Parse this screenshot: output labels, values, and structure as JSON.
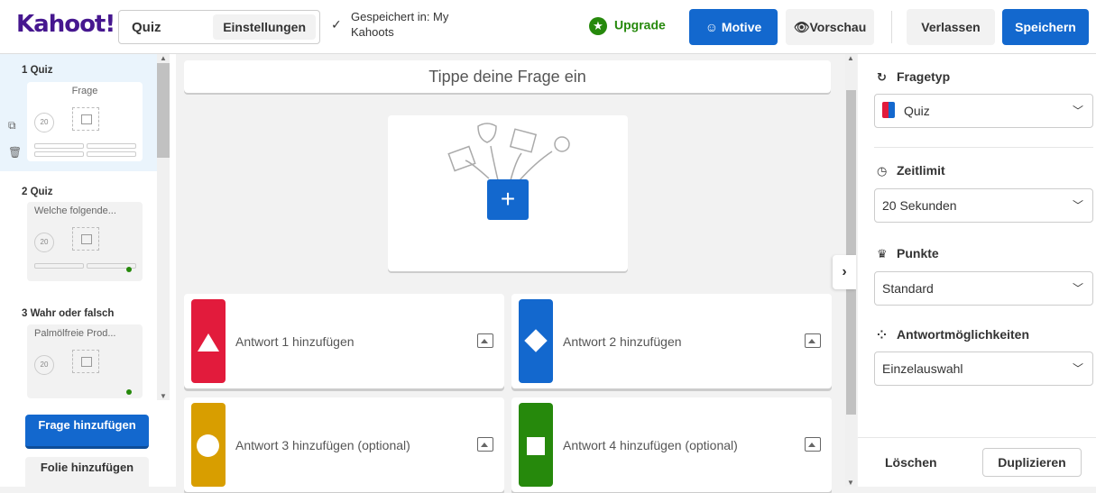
{
  "app": {
    "logo": "Kahoot!"
  },
  "header": {
    "title": "Quiz",
    "settings_label": "Einstellungen",
    "saved_text": "Gespeichert in: My Kahoots",
    "upgrade_label": "Upgrade",
    "themes_label": "Motive",
    "preview_label": "Vorschau",
    "leave_label": "Verlassen",
    "save_label": "Speichern"
  },
  "slides": [
    {
      "label": "1  Quiz",
      "question": "Frage",
      "timer": "20"
    },
    {
      "label": "2  Quiz",
      "question": "Welche folgende...",
      "timer": "20"
    },
    {
      "label": "3  Wahr oder falsch",
      "question": "Palmölfreie Prod...",
      "timer": "20"
    }
  ],
  "sidebar": {
    "add_question": "Frage hinzufügen",
    "add_slide": "Folie hinzufügen"
  },
  "editor": {
    "question_placeholder": "Tippe deine Frage ein",
    "answers": [
      {
        "label": "Antwort 1 hinzufügen",
        "color": "#e21b3c",
        "shape": "triangle"
      },
      {
        "label": "Antwort 2 hinzufügen",
        "color": "#1368ce",
        "shape": "diamond"
      },
      {
        "label": "Antwort 3 hinzufügen (optional)",
        "color": "#d89e00",
        "shape": "circle"
      },
      {
        "label": "Antwort 4 hinzufügen (optional)",
        "color": "#26890c",
        "shape": "square"
      }
    ]
  },
  "settings_panel": {
    "question_type_label": "Fragetyp",
    "question_type_value": "Quiz",
    "time_limit_label": "Zeitlimit",
    "time_limit_value": "20 Sekunden",
    "points_label": "Punkte",
    "points_value": "Standard",
    "answer_options_label": "Antwortmöglichkeiten",
    "answer_options_value": "Einzelauswahl",
    "delete_label": "Löschen",
    "duplicate_label": "Duplizieren"
  },
  "colors": {
    "brand": "#46178f",
    "primary": "#1368ce",
    "success": "#26890c"
  }
}
